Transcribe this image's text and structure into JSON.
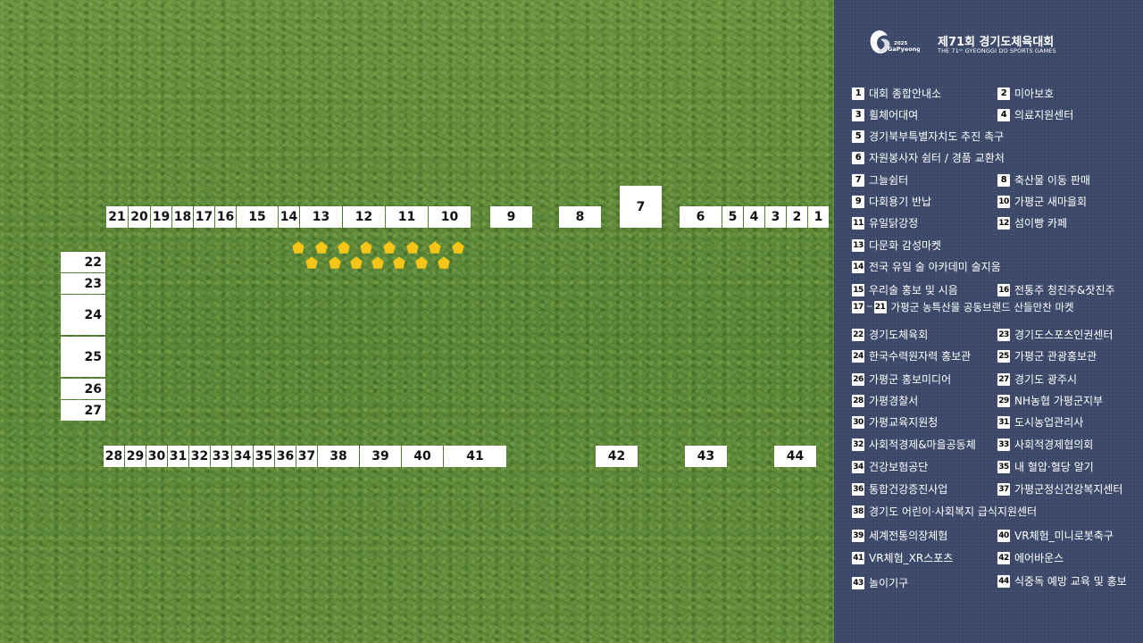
{
  "map": {
    "top_row": [
      "21",
      "20",
      "19",
      "18",
      "17",
      "16",
      "15",
      "14",
      "13",
      "12",
      "11",
      "10",
      "9",
      "8",
      "7",
      "6",
      "5",
      "4",
      "3",
      "2",
      "1"
    ],
    "left_column": [
      "22",
      "23",
      "24",
      "25",
      "26",
      "27"
    ],
    "bottom_row": [
      "28",
      "29",
      "30",
      "31",
      "32",
      "33",
      "34",
      "35",
      "36",
      "37",
      "38",
      "39",
      "40",
      "41",
      "42",
      "43",
      "44"
    ],
    "star_color": "#f5c518",
    "grass_color": "#5e8a3a"
  },
  "panel": {
    "logo": {
      "year": "2025",
      "name": "GaPyeong",
      "icon": "gapyeong-swirl-logo"
    },
    "title": "제71회 경기도체육대회",
    "subtitle": "THE 71ˢᵗ GYEONGGI DO SPORTS GAMES",
    "background_color": "#3d4a6b",
    "legend": [
      {
        "num": "1",
        "label": "대회 종합안내소"
      },
      {
        "num": "2",
        "label": "미아보호"
      },
      {
        "num": "3",
        "label": "휠체어대여"
      },
      {
        "num": "4",
        "label": "의료지원센터"
      },
      {
        "num": "5",
        "label": "경기북부특별자치도 추진 촉구"
      },
      {
        "num": "6",
        "label": "자원봉사자 쉼터 / 경품 교환처"
      },
      {
        "num": "7",
        "label": "그늘쉼터"
      },
      {
        "num": "8",
        "label": "축산물 이동 판매"
      },
      {
        "num": "9",
        "label": "다회용기 반납"
      },
      {
        "num": "10",
        "label": "가평군 새마을회"
      },
      {
        "num": "11",
        "label": "유일닭강정"
      },
      {
        "num": "12",
        "label": "섬이빵 카페"
      },
      {
        "num": "13",
        "label": "다문화 감성마켓"
      },
      {
        "num": "14",
        "label": "전국 유일 술 아카데미 술지움"
      },
      {
        "num": "15",
        "label": "우리술 홍보 및 시음"
      },
      {
        "num": "16",
        "label": "전통주 청진주&잣진주"
      },
      {
        "num": "17~21",
        "num_a": "17",
        "num_sep": "~",
        "num_b": "21",
        "label": "가평군 농특산물 공동브랜드 산들만찬 마켓"
      },
      {
        "num": "22",
        "label": "경기도체육회"
      },
      {
        "num": "23",
        "label": "경기도스포츠인권센터"
      },
      {
        "num": "24",
        "label": "한국수력원자력 홍보관"
      },
      {
        "num": "25",
        "label": "가평군 관광홍보관"
      },
      {
        "num": "26",
        "label": "가평군 홍보미디어"
      },
      {
        "num": "27",
        "label": "경기도 광주시"
      },
      {
        "num": "28",
        "label": "가평경찰서"
      },
      {
        "num": "29",
        "label": "NH농협 가평군지부"
      },
      {
        "num": "30",
        "label": "가평교육지원청"
      },
      {
        "num": "31",
        "label": "도시농업관리사"
      },
      {
        "num": "32",
        "label": "사회적경제&마을공동체"
      },
      {
        "num": "33",
        "label": "사회적경제협의회"
      },
      {
        "num": "34",
        "label": "건강보험공단"
      },
      {
        "num": "35",
        "label": "내 혈압·혈당 알기"
      },
      {
        "num": "36",
        "label": "통합건강증진사업"
      },
      {
        "num": "37",
        "label": "가평군정신건강복지센터"
      },
      {
        "num": "38",
        "label": "경기도 어린이·사회복지 급식지원센터"
      },
      {
        "num": "39",
        "label": "세계전통의장체험"
      },
      {
        "num": "40",
        "label": "VR체험_미니로봇축구"
      },
      {
        "num": "41",
        "label": "VR체험_XR스포츠"
      },
      {
        "num": "42",
        "label": "에어바운스"
      },
      {
        "num": "43",
        "label": "놀이기구"
      },
      {
        "num": "44",
        "label": "식중독 예방 교육 및 홍보"
      }
    ]
  }
}
